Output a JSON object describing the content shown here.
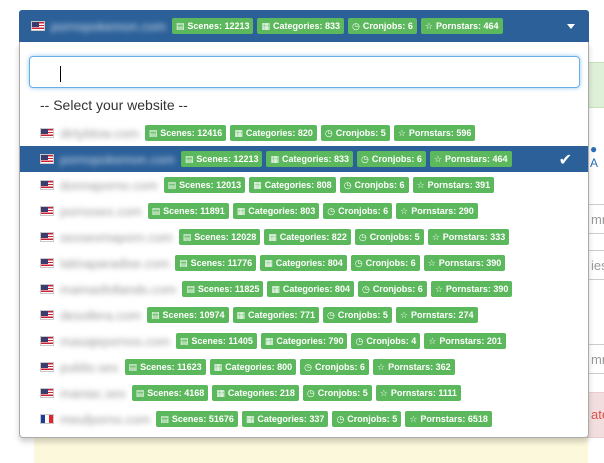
{
  "selected": {
    "site": "pornopokemon.com",
    "badges": {
      "scenes": "Scenes: 12213",
      "categories": "Categories: 833",
      "cronjobs": "Cronjobs: 6",
      "pornstars": "Pornstars: 464"
    }
  },
  "search": {
    "value": ""
  },
  "placeholder_option": "-- Select your website --",
  "options": [
    {
      "site": "dirtyblow.com",
      "flag": "us-flag-icon",
      "scenes": "Scenes: 12416",
      "categories": "Categories: 820",
      "cronjobs": "Cronjobs: 5",
      "pornstars": "Pornstars: 596"
    },
    {
      "site": "pornopokemon.com",
      "flag": "us-flag-icon",
      "scenes": "Scenes: 12213",
      "categories": "Categories: 833",
      "cronjobs": "Cronjobs: 6",
      "pornstars": "Pornstars: 464",
      "selected": true
    },
    {
      "site": "donnaporno.com",
      "flag": "us-flag-icon",
      "scenes": "Scenes: 12013",
      "categories": "Categories: 808",
      "cronjobs": "Cronjobs: 6",
      "pornstars": "Pornstars: 391"
    },
    {
      "site": "pornosex.com",
      "flag": "us-flag-icon",
      "scenes": "Scenes: 11891",
      "categories": "Categories: 803",
      "cronjobs": "Cronjobs: 6",
      "pornstars": "Pornstars: 290"
    },
    {
      "site": "sexsexmaporn.com",
      "flag": "us-flag-icon",
      "scenes": "Scenes: 12028",
      "categories": "Categories: 822",
      "cronjobs": "Cronjobs: 5",
      "pornstars": "Pornstars: 333"
    },
    {
      "site": "latinaparadise.com",
      "flag": "us-flag-icon",
      "scenes": "Scenes: 11776",
      "categories": "Categories: 804",
      "cronjobs": "Cronjobs: 6",
      "pornstars": "Pornstars: 390"
    },
    {
      "site": "mamasfollando.com",
      "flag": "us-flag-icon",
      "scenes": "Scenes: 11825",
      "categories": "Categories: 804",
      "cronjobs": "Cronjobs: 6",
      "pornstars": "Pornstars: 390"
    },
    {
      "site": "desollera.com",
      "flag": "us-flag-icon",
      "scenes": "Scenes: 10974",
      "categories": "Categories: 771",
      "cronjobs": "Cronjobs: 5",
      "pornstars": "Pornstars: 274"
    },
    {
      "site": "masajepornos.com",
      "flag": "us-flag-icon",
      "scenes": "Scenes: 11405",
      "categories": "Categories: 790",
      "cronjobs": "Cronjobs: 4",
      "pornstars": "Pornstars: 201"
    },
    {
      "site": "publio.sex",
      "flag": "us-flag-icon",
      "scenes": "Scenes: 11623",
      "categories": "Categories: 800",
      "cronjobs": "Cronjobs: 6",
      "pornstars": "Pornstars: 362"
    },
    {
      "site": "maniac.sex",
      "flag": "us-flag-icon",
      "scenes": "Scenes: 4168",
      "categories": "Categories: 218",
      "cronjobs": "Cronjobs: 5",
      "pornstars": "Pornstars: 1111"
    },
    {
      "site": "meufporno.com",
      "flag": "fr-flag-icon",
      "scenes": "Scenes: 51676",
      "categories": "Categories: 337",
      "cronjobs": "Cronjobs: 5",
      "pornstars": "Pornstars: 6518"
    }
  ],
  "background": {
    "link_fragment": "A",
    "input_fragment_1": "mm",
    "input_fragment_2": "ies",
    "input_fragment_3": "mm",
    "red_box_fragment": "ate"
  },
  "colors": {
    "header_bg": "#2b6099",
    "badge_bg": "#5cb85c",
    "focus_border": "#66afe9"
  }
}
